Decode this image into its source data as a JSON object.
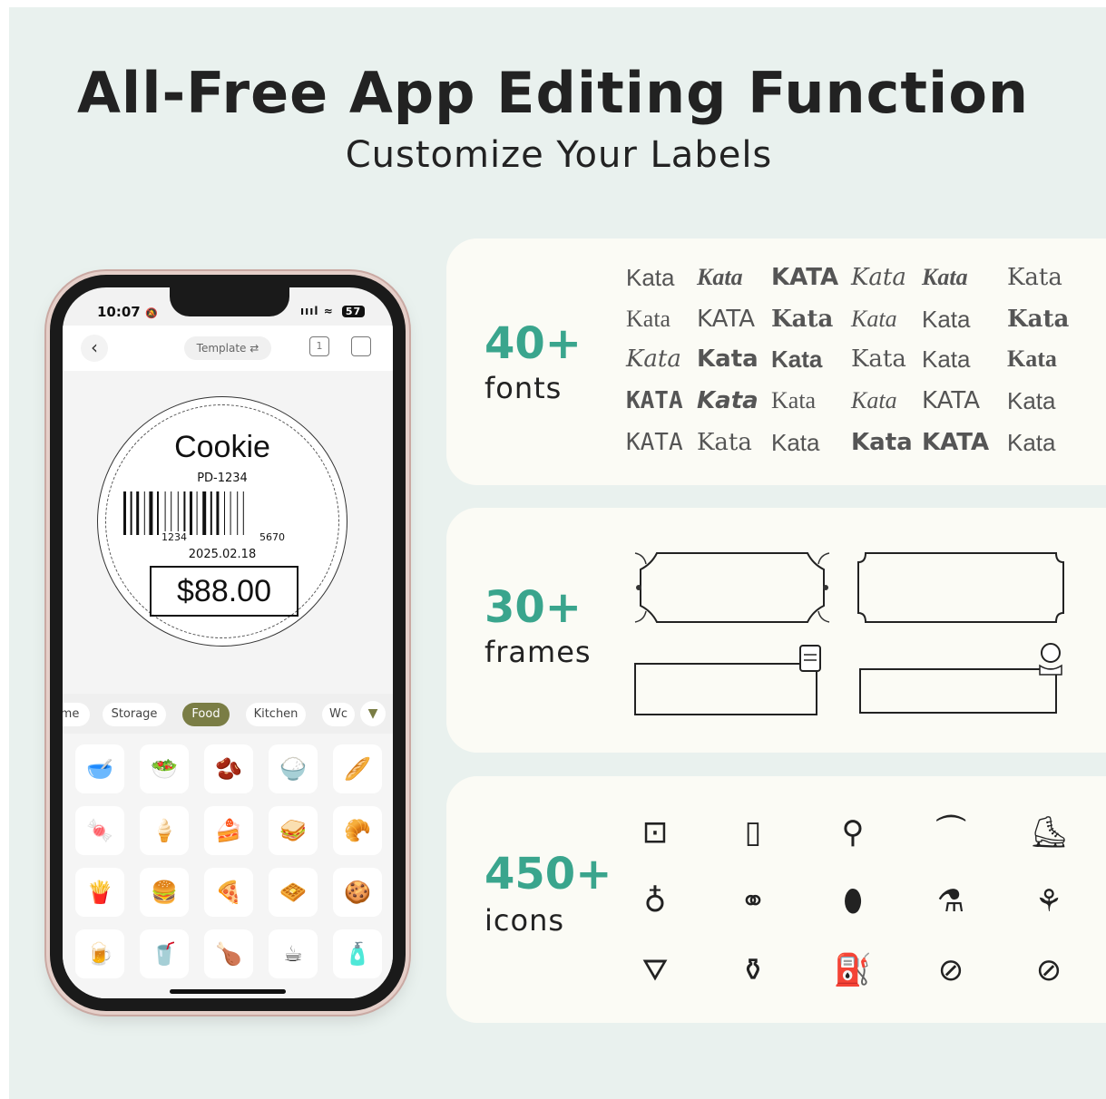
{
  "header": {
    "title": "All-Free App Editing Function",
    "subtitle": "Customize Your Labels"
  },
  "phone": {
    "status": {
      "time": "10:07",
      "bell": "🔕",
      "signal": "ıııl",
      "wifi": "≈",
      "battery": "57"
    },
    "app_header": {
      "back_icon": "‹",
      "template_label": "Template",
      "template_icon": "⇄",
      "page_icon": "1",
      "save_icon": "▭"
    },
    "label": {
      "name": "Cookie",
      "code": "PD-1234",
      "barcode_left": "1234",
      "barcode_right": "5670",
      "date": "2025.02.18",
      "price": "$88.00"
    },
    "categories": [
      {
        "label": "me",
        "active": false
      },
      {
        "label": "Storage",
        "active": false
      },
      {
        "label": "Food",
        "active": true
      },
      {
        "label": "Kitchen",
        "active": false
      },
      {
        "label": "Wc",
        "active": false
      }
    ],
    "more_icon": "▼",
    "icon_tiles": [
      "bowl-fruit-icon",
      "salad-bowl-icon",
      "beans-icon",
      "rice-bowl-icon",
      "bread-icon",
      "candy-icon",
      "ice-cream-icon",
      "cake-icon",
      "sandwich-icon",
      "croissant-icon",
      "fries-icon",
      "burger-icon",
      "pizza-icon",
      "waffle-icon",
      "cookie-icon",
      "beer-mug-icon",
      "drink-cup-icon",
      "roast-chicken-icon",
      "coffee-cup-icon",
      "bottle-icon"
    ],
    "icon_glyphs": [
      "🥣",
      "🥗",
      "🫘",
      "🍚",
      "🥖",
      "🍬",
      "🍦",
      "🍰",
      "🥪",
      "🥐",
      "🍟",
      "🍔",
      "🍕",
      "🧇",
      "🍪",
      "🍺",
      "🥤",
      "🍗",
      "☕",
      "🧴"
    ]
  },
  "fonts_card": {
    "count": "40+",
    "word": "fonts",
    "sample": "Kata"
  },
  "frames_card": {
    "count": "30+",
    "word": "frames"
  },
  "icons_card": {
    "count": "450+",
    "word": "icons",
    "icons": [
      {
        "name": "power-socket-icon",
        "glyph": "⊡"
      },
      {
        "name": "switch-icon",
        "glyph": "▯"
      },
      {
        "name": "desk-lamp-icon",
        "glyph": "⚲"
      },
      {
        "name": "hanger-icon",
        "glyph": "⏜"
      },
      {
        "name": "boot-icon",
        "glyph": "⛸"
      },
      {
        "name": "baby-bottle-icon",
        "glyph": "♁"
      },
      {
        "name": "pacifier-icon",
        "glyph": "⚭"
      },
      {
        "name": "baby-wrap-icon",
        "glyph": "⬮"
      },
      {
        "name": "hair-dryer-icon",
        "glyph": "⚗"
      },
      {
        "name": "earrings-icon",
        "glyph": "⚘"
      },
      {
        "name": "dress-icon",
        "glyph": "⛛"
      },
      {
        "name": "bottles-icon",
        "glyph": "⚱"
      },
      {
        "name": "spray-bottle-icon",
        "glyph": "⛽"
      },
      {
        "name": "compact-powder-icon",
        "glyph": "⊘"
      },
      {
        "name": "compact-mirror-icon",
        "glyph": "⊘"
      }
    ]
  }
}
